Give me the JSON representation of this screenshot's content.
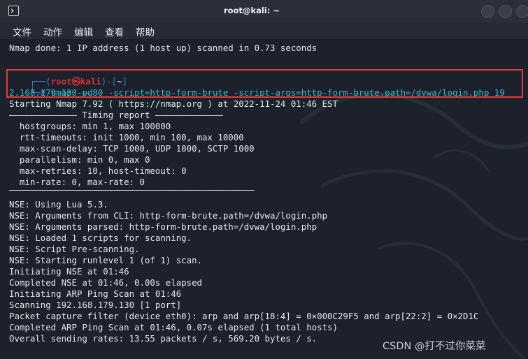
{
  "window": {
    "title": "root@kali: ~"
  },
  "menu": [
    {
      "label": "文件"
    },
    {
      "label": "动作"
    },
    {
      "label": "编辑"
    },
    {
      "label": "查看"
    },
    {
      "label": "帮助"
    }
  ],
  "terminal": {
    "nmap_done": "Nmap done: 1 IP address (1 host up) scanned in 0.73 seconds",
    "prompt": {
      "open": "┌──(",
      "user": "root㉿kali",
      "close": ")-[",
      "dir": "~",
      "end": "]",
      "hash": "└─# "
    },
    "command_line1": "nmap -p 80 -script=http-form-brute -script-args=http-form-brute.path=/dvwa/login.php 19",
    "command_line2": "2.168.179.130 -d",
    "output": [
      "Starting Nmap 7.92 ( https://nmap.org ) at 2022-11-24 01:46 EST",
      "————————————— Timing report —————————————",
      "  hostgroups: min 1, max 100000",
      "  rtt-timeouts: init 1000, min 100, max 10000",
      "  max-scan-delay: TCP 1000, UDP 1000, SCTP 1000",
      "  parallelism: min 0, max 0",
      "  max-retries: 10, host-timeout: 0",
      "  min-rate: 0, max-rate: 0",
      "———————————————————————————————————————————————",
      "NSE: Using Lua 5.3.",
      "NSE: Arguments from CLI: http-form-brute.path=/dvwa/login.php",
      "NSE: Arguments parsed: http-form-brute.path=/dvwa/login.php",
      "NSE: Loaded 1 scripts for scanning.",
      "NSE: Script Pre-scanning.",
      "NSE: Starting runlevel 1 (of 1) scan.",
      "Initiating NSE at 01:46",
      "Completed NSE at 01:46, 0.00s elapsed",
      "Initiating ARP Ping Scan at 01:46",
      "Scanning 192.168.179.130 [1 port]",
      "Packet capture filter (device eth0): arp and arp[18:4] = 0×000C29F5 and arp[22:2] = 0×2D1C",
      "Completed ARP Ping Scan at 01:46, 0.07s elapsed (1 total hosts)",
      "Overall sending rates: 13.55 packets / s, 569.20 bytes / s."
    ]
  },
  "watermark": "CSDN @打不过你菜菜",
  "colors": {
    "prompt_frame": "#3a7dd6",
    "prompt_user": "#d1323b",
    "command": "#2fbcd3",
    "highlight_box": "#e23a3a"
  },
  "icons": [
    "terminal-icon",
    "minimize-button",
    "maximize-button",
    "close-button",
    "kali-dragon-logo"
  ]
}
